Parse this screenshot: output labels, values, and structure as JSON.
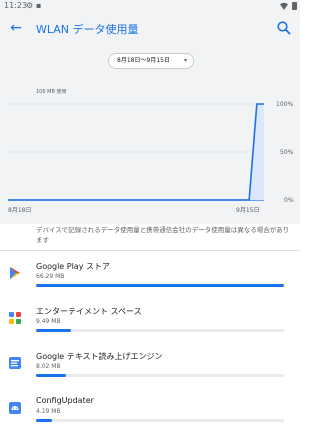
{
  "status_bar": {
    "time": "11:23"
  },
  "app_bar": {
    "title": "WLAN データ使用量",
    "back_icon": "arrow-back-icon",
    "search_icon": "search-icon"
  },
  "cycle": {
    "label": "8月18日～9月15日",
    "caret": "▾"
  },
  "chart_data": {
    "type": "area",
    "usage_label": "106 MB 使用",
    "y_ticks": [
      "100%",
      "50%",
      "0%"
    ],
    "x_labels": [
      "8月18日",
      "9月15日"
    ],
    "x": [
      "8月18日",
      "9月13日",
      "9月14日",
      "9月15日"
    ],
    "y": [
      0,
      0,
      100,
      100
    ],
    "ylim": [
      0,
      100
    ]
  },
  "disclaimer": "デバイスで記録されるデータ使用量と携帯通信会社のデータ使用量は異なる場合があります",
  "accent": "#1a73e8",
  "apps": [
    {
      "name": "Google Play ストア",
      "usage": "66.29 MB",
      "fraction": 1.0,
      "icon": "google-play-store-icon"
    },
    {
      "name": "エンターテイメント スペース",
      "usage": "9.49 MB",
      "fraction": 0.14,
      "icon": "entertainment-space-icon"
    },
    {
      "name": "Google テキスト読み上げエンジン",
      "usage": "8.02 MB",
      "fraction": 0.12,
      "icon": "google-tts-icon"
    },
    {
      "name": "ConfigUpdater",
      "usage": "4.19 MB",
      "fraction": 0.065,
      "icon": "android-robot-icon"
    }
  ]
}
